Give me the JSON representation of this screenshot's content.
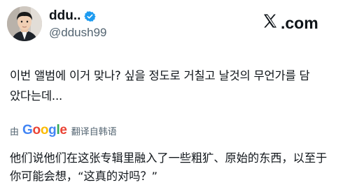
{
  "author": {
    "display_name": "ddu..",
    "handle": "@ddush99",
    "verified": true
  },
  "brand": {
    "label": "𝕏.com",
    "text": ".com"
  },
  "tweet": {
    "text": "이번 앨범에 이거 맞나? 싶을 정도로 거칠고 날것의 무언가를 담\n았다는데..."
  },
  "translation_bar": {
    "prefix": "由",
    "google_letters": [
      "G",
      "o",
      "o",
      "g",
      "l",
      "e"
    ],
    "suffix": "翻译自韩语"
  },
  "translation": {
    "text": "他们说他们在这张专辑里融入了一些粗犷、原始的东西，以至于\n你可能会想，“这真的对吗？”"
  },
  "colors": {
    "verified": "#1d9bf0",
    "muted": "#536471",
    "text": "#0f1419"
  }
}
